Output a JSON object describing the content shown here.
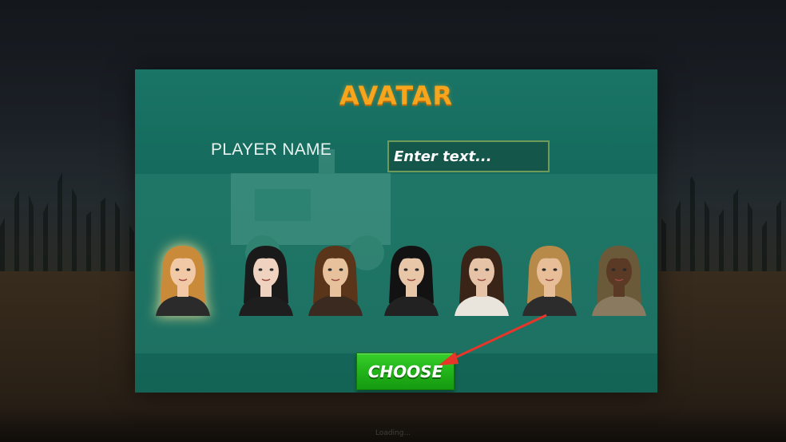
{
  "dialog": {
    "title": "AVATAR",
    "player_name_label": "PLAYER NAME",
    "player_name_placeholder": "Enter text...",
    "choose_label": "CHOOSE"
  },
  "avatars": [
    {
      "id": "avatar-1",
      "hair": "#c98a3a",
      "skin": "#f2c9a6",
      "outfit": "#2b2b2b",
      "selected": true
    },
    {
      "id": "avatar-2",
      "hair": "#1a1a1a",
      "skin": "#efd2c0",
      "outfit": "#1e1e1e",
      "selected": false
    },
    {
      "id": "avatar-3",
      "hair": "#5a3519",
      "skin": "#e7c09c",
      "outfit": "#3a2a20",
      "selected": false
    },
    {
      "id": "avatar-4",
      "hair": "#121212",
      "skin": "#e8c6a8",
      "outfit": "#222222",
      "selected": false
    },
    {
      "id": "avatar-5",
      "hair": "#3a2418",
      "skin": "#e6c3a6",
      "outfit": "#e9e4dc",
      "selected": false
    },
    {
      "id": "avatar-6",
      "hair": "#b88a4a",
      "skin": "#e7be98",
      "outfit": "#2c2c2c",
      "selected": false
    },
    {
      "id": "avatar-7",
      "hair": "#6b5a3a",
      "skin": "#5a3a24",
      "outfit": "#8a7a60",
      "selected": false
    }
  ],
  "colors": {
    "title": "#f6a51c",
    "dialog": "#16695b",
    "button": "#22b31a",
    "arrow": "#e8352a"
  },
  "background_caption": "Loading..."
}
